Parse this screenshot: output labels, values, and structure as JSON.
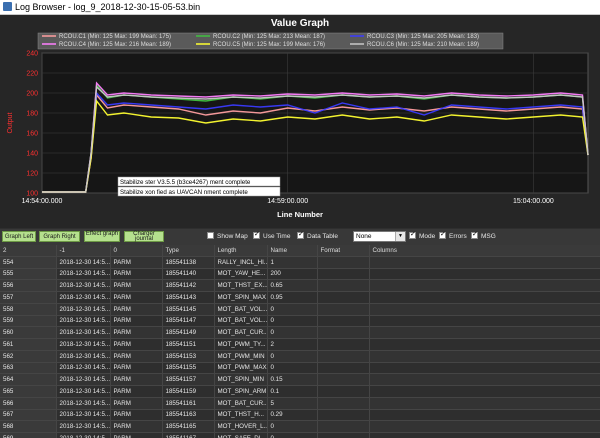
{
  "window": {
    "title": "Log Browser - log_9_2018-12-30-15-05-53.bin"
  },
  "graph": {
    "title": "Value Graph",
    "ylabel": "Output",
    "xlabel": "Line Number",
    "yticks": [
      "240",
      "220",
      "200",
      "180",
      "160",
      "140",
      "120",
      "100"
    ],
    "xticks": [
      "14:54:00.000",
      "14:59:00.000",
      "15:04:00.000"
    ],
    "legend": [
      {
        "label": "RCOU.C1 (Min: 125 Max: 199 Mean: 175)",
        "color": "#ff9ea0"
      },
      {
        "label": "RCOU.C2 (Min: 125 Max: 213 Mean: 187)",
        "color": "#40c040"
      },
      {
        "label": "RCOU.C3 (Min: 125 Max: 205 Mean: 183)",
        "color": "#3a3aff"
      },
      {
        "label": "RCOU.C4 (Min: 125 Max: 216 Mean: 189)",
        "color": "#ff80ff"
      },
      {
        "label": "RCOU.C5 (Min: 125 Max: 199 Mean: 176)",
        "color": "#ffff30"
      },
      {
        "label": "RCOU.C6 (Min: 125 Max: 210 Mean: 189)",
        "color": "#c8c8c8"
      }
    ],
    "annotations": [
      "Stabilize  ster V3.5.5 (b3ce4267)  ment complete",
      "Stabilize  xon  fied as UAVCAN  nment complete"
    ]
  },
  "chart_data": {
    "type": "line",
    "title": "Value Graph",
    "xlabel": "Line Number",
    "ylabel": "Output",
    "ylim": [
      100,
      240
    ],
    "x_ticks": [
      "14:54:00.000",
      "14:59:00.000",
      "15:04:00.000"
    ],
    "x": [
      0,
      3,
      8,
      9,
      10,
      12,
      15,
      20,
      25,
      30,
      35,
      40,
      45,
      50,
      55,
      60,
      65,
      70,
      75,
      80,
      85,
      90,
      95,
      99,
      100
    ],
    "series": [
      {
        "name": "RCOU.C1",
        "values": [
          101,
          101,
          101,
          135,
          198,
          185,
          188,
          186,
          184,
          178,
          182,
          180,
          185,
          182,
          186,
          183,
          185,
          182,
          186,
          184,
          182,
          184,
          186,
          184,
          138
        ]
      },
      {
        "name": "RCOU.C2",
        "values": [
          101,
          101,
          101,
          140,
          208,
          195,
          198,
          196,
          194,
          192,
          196,
          194,
          197,
          195,
          198,
          196,
          197,
          194,
          198,
          196,
          195,
          196,
          198,
          196,
          138
        ]
      },
      {
        "name": "RCOU.C3",
        "values": [
          101,
          101,
          101,
          138,
          200,
          188,
          190,
          188,
          186,
          184,
          188,
          186,
          188,
          180,
          190,
          184,
          186,
          178,
          188,
          186,
          184,
          186,
          188,
          186,
          138
        ]
      },
      {
        "name": "RCOU.C4",
        "values": [
          101,
          101,
          101,
          140,
          210,
          198,
          200,
          198,
          197,
          196,
          198,
          197,
          199,
          198,
          200,
          198,
          199,
          197,
          200,
          198,
          197,
          198,
          200,
          198,
          138
        ]
      },
      {
        "name": "RCOU.C5",
        "values": [
          101,
          101,
          101,
          135,
          192,
          178,
          180,
          176,
          175,
          170,
          174,
          172,
          176,
          174,
          178,
          174,
          176,
          172,
          178,
          176,
          174,
          176,
          178,
          176,
          138
        ]
      },
      {
        "name": "RCOU.C6",
        "values": [
          101,
          101,
          101,
          140,
          206,
          196,
          198,
          196,
          195,
          194,
          196,
          195,
          197,
          196,
          198,
          196,
          197,
          195,
          198,
          196,
          195,
          196,
          198,
          196,
          138
        ]
      }
    ]
  },
  "buttons": {
    "graph_left": "Graph Left",
    "graph_right": "Graph Right",
    "effect_graph": "Effect graph",
    "charger_journal": "Charger journal"
  },
  "options": {
    "show_map": "Show Map",
    "use_time": "Use Time",
    "data_table": "Data Table",
    "mode_select": "None",
    "mode": "Mode",
    "errors": "Errors",
    "msg": "MSG"
  },
  "table": {
    "columns": [
      "2",
      "-1",
      "0",
      "Type",
      "Length",
      "Name",
      "Format",
      "Columns"
    ],
    "rows": [
      [
        "554",
        "2018-12-30 14:5...",
        "PARM",
        "185541138",
        "RALLY_INCL_HI...",
        "1",
        "",
        ""
      ],
      [
        "555",
        "2018-12-30 14:5...",
        "PARM",
        "185541140",
        "MOT_YAW_HE...",
        "200",
        "",
        ""
      ],
      [
        "556",
        "2018-12-30 14:5...",
        "PARM",
        "185541142",
        "MOT_THST_EX...",
        "0.65",
        "",
        ""
      ],
      [
        "557",
        "2018-12-30 14:5...",
        "PARM",
        "185541143",
        "MOT_SPIN_MAX",
        "0.95",
        "",
        ""
      ],
      [
        "558",
        "2018-12-30 14:5...",
        "PARM",
        "185541145",
        "MOT_BAT_VOL...",
        "0",
        "",
        ""
      ],
      [
        "559",
        "2018-12-30 14:5...",
        "PARM",
        "185541147",
        "MOT_BAT_VOL...",
        "0",
        "",
        ""
      ],
      [
        "560",
        "2018-12-30 14:5...",
        "PARM",
        "185541149",
        "MOT_BAT_CUR...",
        "0",
        "",
        ""
      ],
      [
        "561",
        "2018-12-30 14:5...",
        "PARM",
        "185541151",
        "MOT_PWM_TY...",
        "2",
        "",
        ""
      ],
      [
        "562",
        "2018-12-30 14:5...",
        "PARM",
        "185541153",
        "MOT_PWM_MIN",
        "0",
        "",
        ""
      ],
      [
        "563",
        "2018-12-30 14:5...",
        "PARM",
        "185541155",
        "MOT_PWM_MAX",
        "0",
        "",
        ""
      ],
      [
        "564",
        "2018-12-30 14:5...",
        "PARM",
        "185541157",
        "MOT_SPIN_MIN",
        "0.15",
        "",
        ""
      ],
      [
        "565",
        "2018-12-30 14:5...",
        "PARM",
        "185541159",
        "MOT_SPIN_ARM",
        "0.1",
        "",
        ""
      ],
      [
        "566",
        "2018-12-30 14:5...",
        "PARM",
        "185541161",
        "MOT_BAT_CUR...",
        "5",
        "",
        ""
      ],
      [
        "567",
        "2018-12-30 14:5...",
        "PARM",
        "185541163",
        "MOT_THST_H...",
        "0.29",
        "",
        ""
      ],
      [
        "568",
        "2018-12-30 14:5...",
        "PARM",
        "185541165",
        "MOT_HOVER_L...",
        "0",
        "",
        ""
      ],
      [
        "569",
        "2018-12-30 14:5...",
        "PARM",
        "185541167",
        "MOT_SAFE_DI...",
        "0",
        "",
        ""
      ]
    ]
  }
}
